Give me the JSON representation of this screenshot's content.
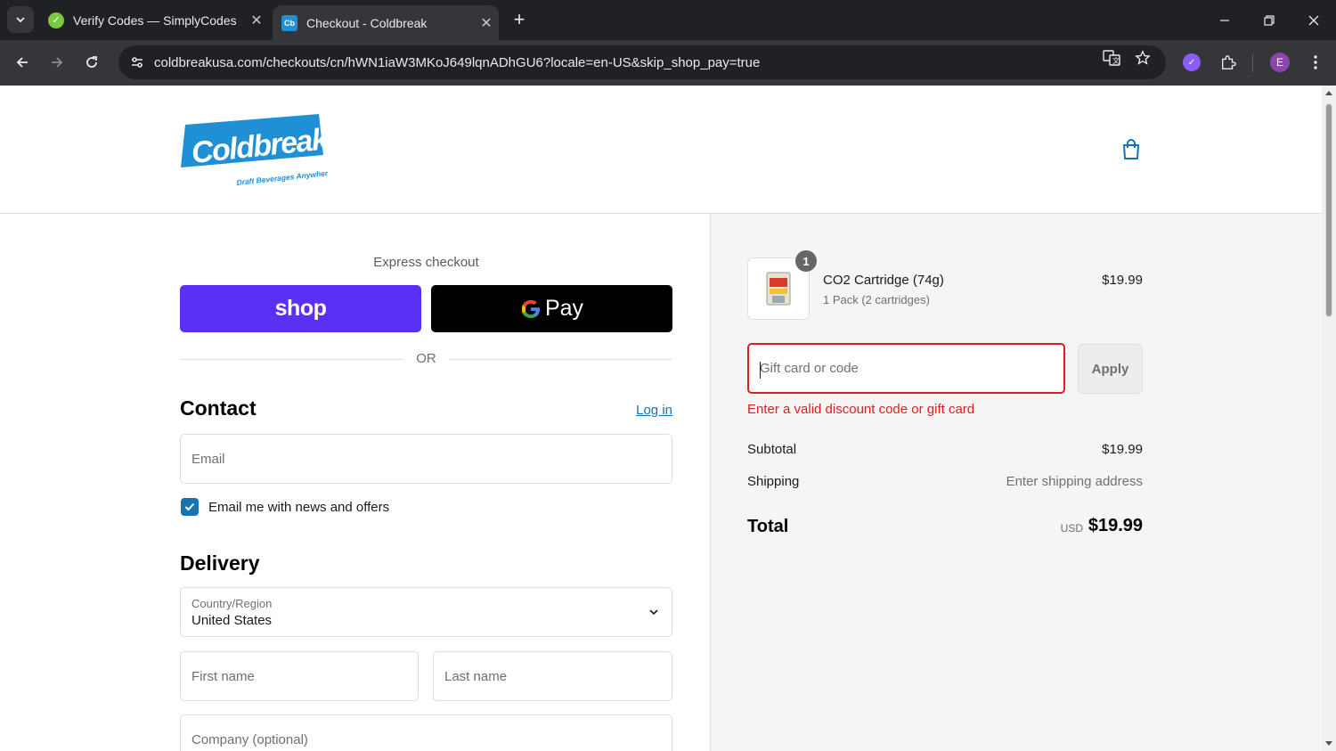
{
  "browser": {
    "tabs": [
      {
        "title": "Verify Codes — SimplyCodes",
        "active": false,
        "icon": "simplycodes-favicon"
      },
      {
        "title": "Checkout - Coldbreak",
        "active": true,
        "icon": "coldbreak-favicon"
      }
    ],
    "new_tab_symbol": "+",
    "url": "coldbreakusa.com/checkouts/cn/hWN1iaW3MKoJ649lqnADhGU6?locale=en-US&skip_shop_pay=true",
    "profile_initial": "E"
  },
  "header": {
    "logo_text": "Coldbreak",
    "logo_tagline": "Draft Beverages Anywhere",
    "brand_color": "#1f8fd6"
  },
  "checkout": {
    "express_label": "Express checkout",
    "shop_pay_label": "shop",
    "gpay_label": "Pay",
    "or_label": "OR",
    "contact_heading": "Contact",
    "login_link": "Log in",
    "email_placeholder": "Email",
    "newsletter_label": "Email me with news and offers",
    "newsletter_checked": true,
    "delivery_heading": "Delivery",
    "country_label": "Country/Region",
    "country_value": "United States",
    "first_name_placeholder": "First name",
    "last_name_placeholder": "Last name",
    "company_placeholder": "Company (optional)"
  },
  "summary": {
    "item": {
      "quantity": "1",
      "name": "CO2 Cartridge (74g)",
      "variant": "1 Pack (2 cartridges)",
      "price": "$19.99"
    },
    "discount_placeholder": "Gift card or code",
    "apply_label": "Apply",
    "error_message": "Enter a valid discount code or gift card",
    "subtotal_label": "Subtotal",
    "subtotal_value": "$19.99",
    "shipping_label": "Shipping",
    "shipping_value": "Enter shipping address",
    "total_label": "Total",
    "total_currency": "USD",
    "total_value": "$19.99"
  },
  "colors": {
    "shop_pay": "#5a31f4",
    "link": "#1773b0",
    "error": "#dd1d1d"
  }
}
